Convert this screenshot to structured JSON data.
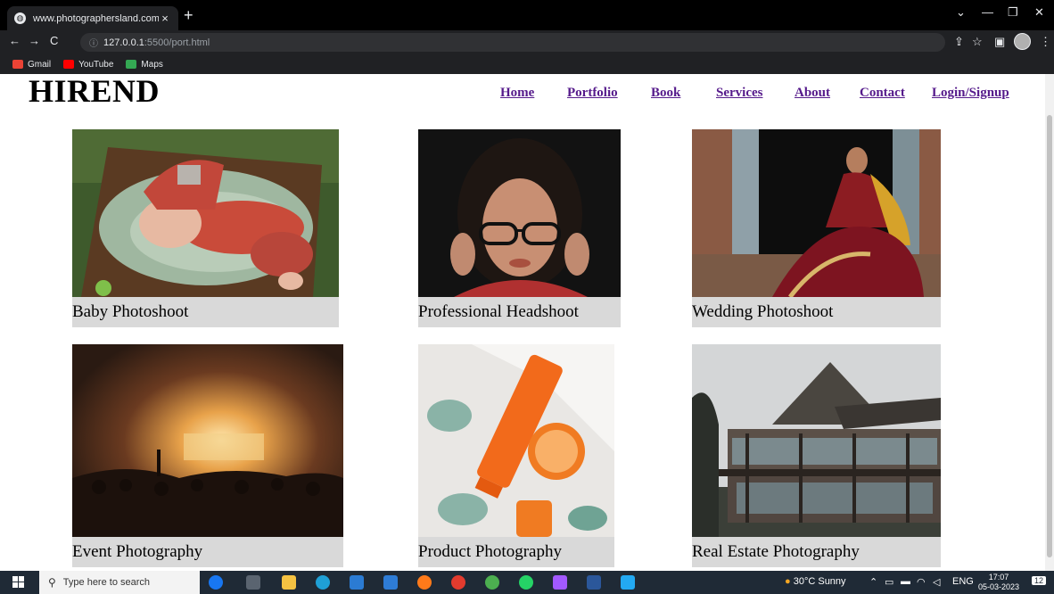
{
  "browser": {
    "tab_title": "www.photographersland.com",
    "tab_close": "×",
    "new_tab": "+",
    "url_host": "127.0.0.1",
    "url_path": ":5500/port.html",
    "bookmarks": [
      {
        "label": "Gmail",
        "icon": "gmail-icon",
        "color": "#ea4335"
      },
      {
        "label": "YouTube",
        "icon": "youtube-icon",
        "color": "#ff0000"
      },
      {
        "label": "Maps",
        "icon": "maps-icon",
        "color": "#34a853"
      }
    ]
  },
  "site": {
    "logo": "HIREND",
    "nav": [
      "Home",
      "Portfolio",
      "Book",
      "Services",
      "About",
      "Contact",
      "Login/Signup"
    ],
    "link_color": "#551a8b",
    "caption_bg": "#d9d9d9"
  },
  "gallery": [
    {
      "caption": "Baby Photoshoot",
      "image": "baby-photo"
    },
    {
      "caption": "Professional Headshoot",
      "image": "headshot-photo"
    },
    {
      "caption": "Wedding Photoshoot",
      "image": "wedding-photo"
    },
    {
      "caption": "Event Photography",
      "image": "concert-photo"
    },
    {
      "caption": "Product Photography",
      "image": "product-photo"
    },
    {
      "caption": "Real Estate Photography",
      "image": "house-photo"
    }
  ],
  "taskbar": {
    "search_placeholder": "Type here to search",
    "weather": "30°C  Sunny",
    "language": "ENG",
    "time": "17:07",
    "date": "05-03-2023",
    "notifications": "12"
  }
}
